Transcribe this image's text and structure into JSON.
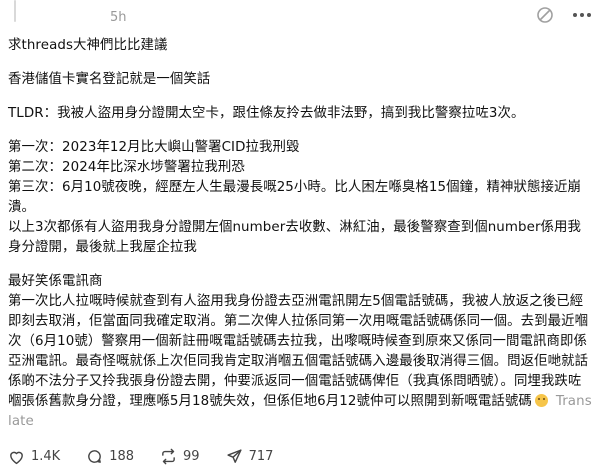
{
  "post": {
    "timestamp": "5h",
    "title": "求threads大神們比比建議",
    "intro": "香港儲值卡實名登記就是一個笑話",
    "tldr": "TLDR：我被人盜用身分證開太空卡，跟住條友拎去做非法野，搞到我比警察拉咗3次。",
    "arrests": [
      "第一次：2023年12月比大嶼山警署CID拉我刑毀",
      "第二次：2024年比深水埗警署拉我刑恐",
      "第三次：6月10號夜晚，經歷左人生最漫長嘅25小時。比人困左喺臭格15個鐘，精神狀態接近崩潰。"
    ],
    "summary": "以上3次都係有人盜用我身分證開左個number去收數、淋紅油，最後警察查到個number係用我身分證開，最後就上我屋企拉我",
    "carrier_heading": "最好笑係電訊商",
    "carrier_body": "第一次比人拉嘅時候就查到有人盜用我身份證去亞洲電訊開左5個電話號碼，我被人放返之後已經即刻去取消，佢當面同我確定取消。第二次俾人拉係同第一次用嘅電話號碼係同一個。去到最近嗰次（6月10號）警察用一個新註冊嘅電話號碼去拉我，出嚟嘅時候查到原來又係同一間電訊商即係亞洲電訊。最奇怪嘅就係上次佢同我肯定取消嗰五個電話號碼入邊最後取消得三個。問返佢哋就話係啲不法分子又拎我張身份證去開，仲要派返同一個電話號碼俾佢（我真係問晒號）。同埋我跌咗嗰張係舊款身分證，理應喺5月18號失效，但係佢地6月12號仲可以照開到新嘅電話號碼",
    "translate_label": "Translate"
  },
  "actions": {
    "likes": "1.4K",
    "replies": "188",
    "reposts": "99",
    "shares": "717"
  },
  "icons": {
    "header": [
      "no-distraction-icon",
      "more-icon"
    ],
    "actions": [
      "heart-icon",
      "comment-icon",
      "repost-icon",
      "share-icon"
    ],
    "emoji": "crying-face-emoji"
  },
  "colors": {
    "text": "#101010",
    "muted": "#999999",
    "action_text": "#444444"
  }
}
